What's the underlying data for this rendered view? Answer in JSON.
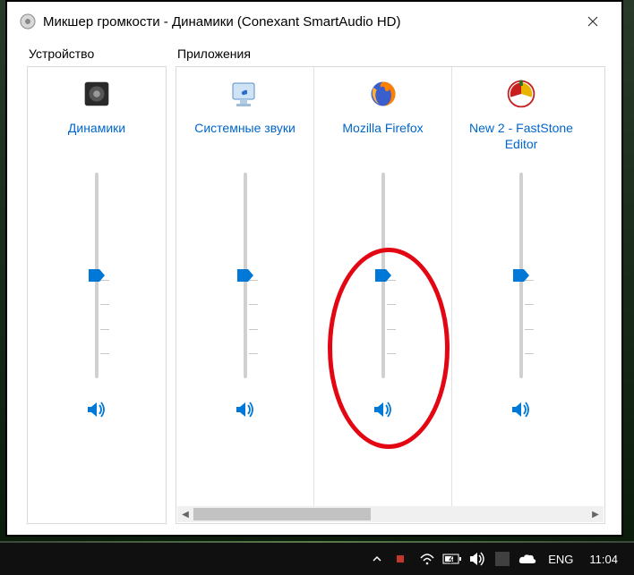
{
  "window": {
    "title": "Микшер громкости - Динамики (Conexant SmartAudio HD)"
  },
  "sections": {
    "device": "Устройство",
    "apps": "Приложения"
  },
  "channels": [
    {
      "name": "Динамики",
      "icon": "speaker",
      "level": 50,
      "muted": false
    },
    {
      "name": "Системные звуки",
      "icon": "syssounds",
      "level": 50,
      "muted": false
    },
    {
      "name": "Mozilla Firefox",
      "icon": "firefox",
      "level": 50,
      "muted": false
    },
    {
      "name": "New 2 - FastStone Editor",
      "icon": "faststone",
      "level": 50,
      "muted": false
    }
  ],
  "taskbar": {
    "lang": "ENG",
    "time": "11:04"
  },
  "annotation": {
    "channel_index": 2
  }
}
